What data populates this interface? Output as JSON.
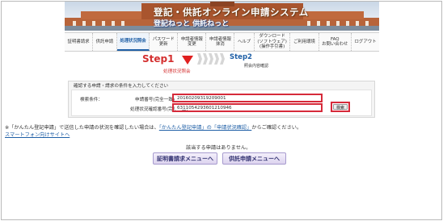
{
  "header": {
    "title": "登記・供託オンライン申請システム",
    "subtitle": "登記ねっと 供託ねっと"
  },
  "nav": {
    "items": [
      {
        "lines": [
          "証明書請求"
        ],
        "active": false
      },
      {
        "lines": [
          "供託申請"
        ],
        "active": false
      },
      {
        "lines": [
          "処理状況照会"
        ],
        "active": true
      },
      {
        "lines": [
          "パスワード",
          "更新"
        ],
        "active": false
      },
      {
        "lines": [
          "申請者情報",
          "変更"
        ],
        "active": false
      },
      {
        "lines": [
          "申請者情報",
          "抹消"
        ],
        "active": false
      },
      {
        "lines": [
          "ヘルプ"
        ],
        "active": false
      },
      {
        "lines": [
          "ダウンロード",
          "(ソフトウェア)",
          "(操作手引書)"
        ],
        "active": false
      },
      {
        "lines": [
          "ご利用環境"
        ],
        "active": false
      },
      {
        "lines": [
          "FAQ",
          "お問い合わせ"
        ],
        "active": false
      },
      {
        "lines": [
          "ログアウト"
        ],
        "active": false
      }
    ]
  },
  "steps": {
    "step1_title": "Step1",
    "step1_sub": "処理状況照会",
    "step2_title": "Step2",
    "step2_sub": "照会内容確認"
  },
  "form": {
    "heading": "確認する申請・請求の条件を入力してください",
    "condition_label": "検索条件：",
    "field1_label": "申請番号(完全一致)",
    "field1_value": "20160209319209001",
    "field2_label": "処理状況確認番号(完全一致)",
    "field2_value": "6311054293601210946",
    "search_button": "検索"
  },
  "note": {
    "prefix": "※「かんたん登記申請」で送信した申請の状況を確認したい場合は、",
    "link": "「かんたん登記申請」の「申請状況確認」",
    "suffix": "からご確認ください。"
  },
  "smartphone_link": "スマートフォン向けサイトへ",
  "no_results": "該当する申請はありません。",
  "buttons": {
    "cert_menu": "証明書請求メニューへ",
    "deposit_menu": "供託申請メニューへ"
  },
  "colors": {
    "accent": "#1f5fa6",
    "highlight": "#d62a3a",
    "step1": "#d43030"
  }
}
